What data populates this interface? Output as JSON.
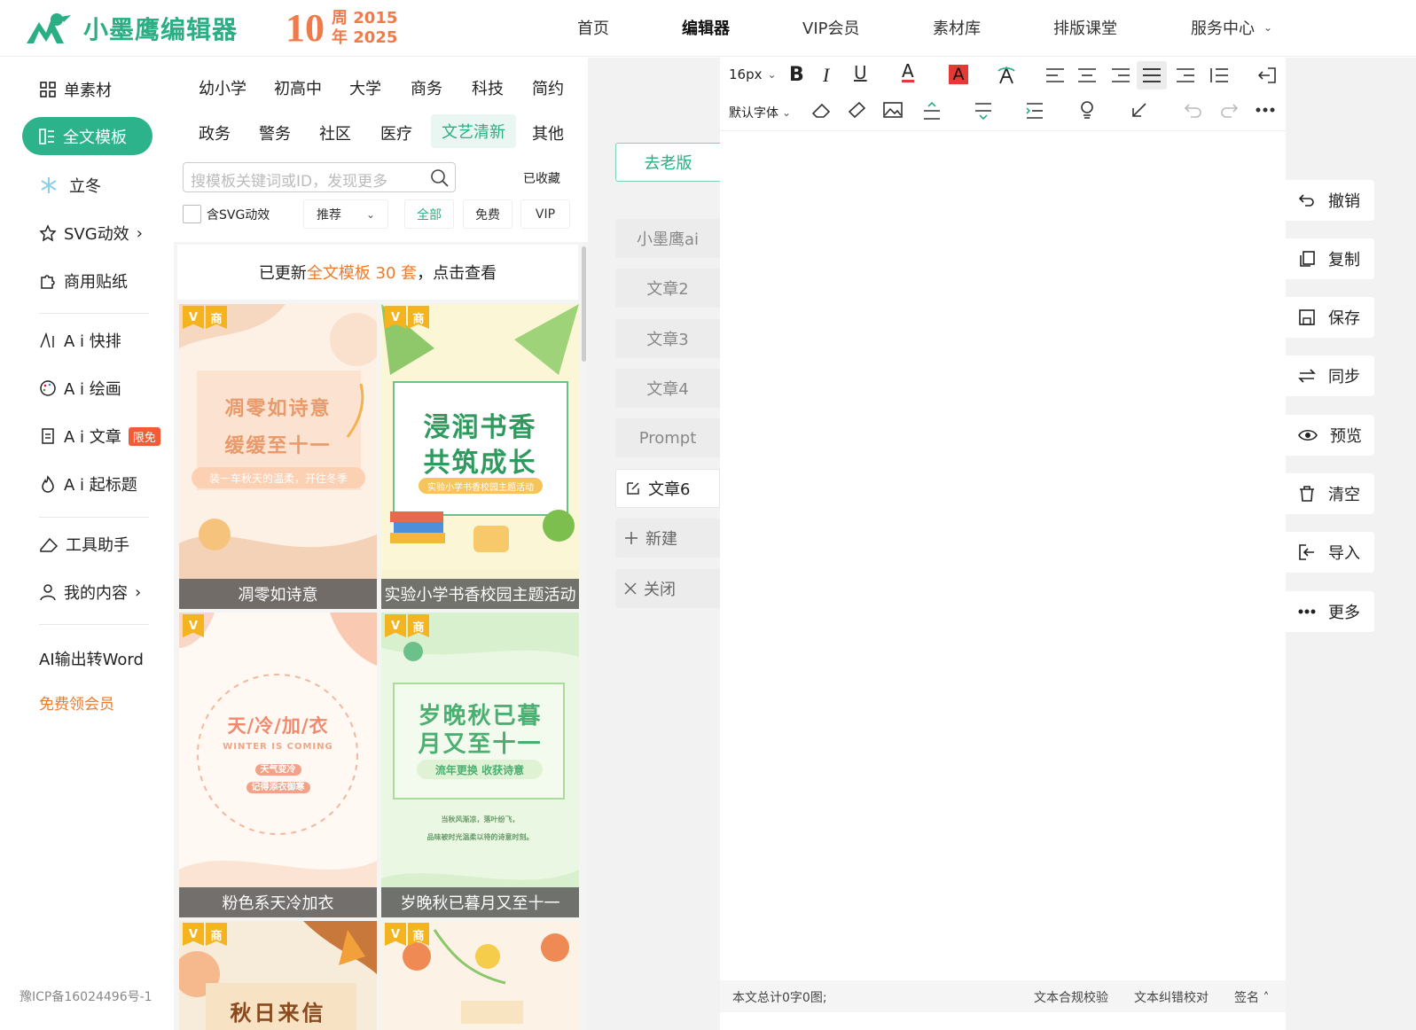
{
  "header": {
    "logo_text": "小墨鹰编辑器",
    "anniv_number": "10",
    "anniv_line1": "周 2015",
    "anniv_line2": "年 2025",
    "nav": [
      {
        "label": "首页"
      },
      {
        "label": "编辑器"
      },
      {
        "label": "VIP会员"
      },
      {
        "label": "素材库"
      },
      {
        "label": "排版课堂"
      },
      {
        "label": "服务中心"
      }
    ],
    "nav_chevron": "⌄"
  },
  "sidebar": {
    "items": [
      {
        "label": "单素材"
      },
      {
        "label": "全文模板"
      },
      {
        "label": "立冬"
      },
      {
        "label": "SVG动效"
      },
      {
        "label": "商用贴纸"
      },
      {
        "label": "A i 快排"
      },
      {
        "label": "A i 绘画"
      },
      {
        "label": "A i 文章",
        "badge": "限免"
      },
      {
        "label": "A i 起标题"
      },
      {
        "label": "工具助手"
      },
      {
        "label": "我的内容"
      },
      {
        "label": "AI输出转Word"
      },
      {
        "label": "免费领会员"
      }
    ],
    "arrow": "›",
    "icp": "豫ICP备16024496号-1"
  },
  "templates": {
    "categories_row1": [
      "幼小学",
      "初高中",
      "大学",
      "商务",
      "科技",
      "简约"
    ],
    "categories_row2": [
      "政务",
      "警务",
      "社区",
      "医疗",
      "文艺清新",
      "其他"
    ],
    "search_placeholder": "搜模板关键词或ID，发现更多",
    "favorites": "已收藏",
    "svg_filter": "含SVG动效",
    "sort": "推荐",
    "filters": [
      "全部",
      "免费",
      "VIP"
    ],
    "notice_prefix": "已更新 ",
    "notice_highlight": "全文模板 30 套",
    "notice_suffix": "，点击查看",
    "tag_v": "V",
    "tag_biz": "商",
    "cards": [
      {
        "caption": "凋零如诗意",
        "line1": "凋零如诗意",
        "line2": "缓缓至十一",
        "sub": "装一车秋天的温柔，开往冬季"
      },
      {
        "caption": "实验小学书香校园主题活动",
        "line1": "浸润书香",
        "line2": "共筑成长",
        "sub": "实验小学书香校园主题活动"
      },
      {
        "caption": "粉色系天冷加衣",
        "line1": "天/冷/加/衣",
        "line2": "WINTER IS COMING",
        "sub": "天气变冷",
        "sub2": "记得添衣御寒"
      },
      {
        "caption": "岁晚秋已暮月又至十一",
        "line1": "岁晚秋已暮",
        "line2": "月又至十一",
        "sub": "流年更换 收获诗意",
        "body1": "当秋风渐凉，落叶纷飞，",
        "body2": "品味被时光温柔以待的诗意时刻。"
      },
      {
        "title_partial": "秋日来信"
      },
      {}
    ]
  },
  "doc_tabs": {
    "old_version": "去老版",
    "tabs": [
      "小墨鹰ai",
      "文章2",
      "文章3",
      "文章4",
      "Prompt",
      "文章6"
    ],
    "new": "新建",
    "close": "关闭"
  },
  "toolbar": {
    "font_size": "16px",
    "font_family": "默认字体"
  },
  "status": {
    "count": "本文总计0字0图;",
    "compliance": "文本合规校验",
    "proofread": "文本纠错校对",
    "sign": "签名"
  },
  "right_actions": [
    "撤销",
    "复制",
    "保存",
    "同步",
    "预览",
    "清空",
    "导入",
    "更多"
  ],
  "colors": {
    "accent": "#2cb38b",
    "orange": "#f07a2a",
    "badge": "#f05b3a"
  }
}
